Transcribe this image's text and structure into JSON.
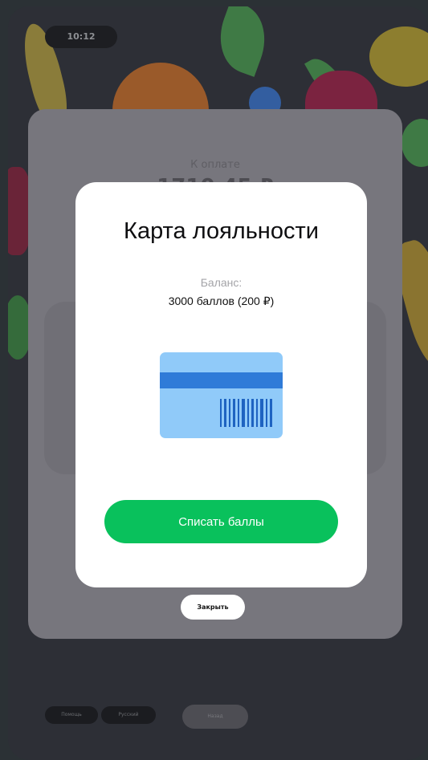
{
  "status": {
    "time": "10:12"
  },
  "payment_panel": {
    "label": "К оплате",
    "amount": "1710.45 ₽"
  },
  "loyalty_modal": {
    "title": "Карта лояльности",
    "balance_label": "Баланс:",
    "balance_value": "3000 баллов (200 ₽)",
    "action_label": "Списать баллы",
    "card_icon": "loyalty-card-icon"
  },
  "close_label": "Закрыть",
  "footer": {
    "help_label": "Помощь",
    "language_label": "Русский",
    "back_label": "Назад"
  },
  "colors": {
    "accent": "#09c15c",
    "card_light": "#90caf9",
    "card_stripe": "#2f7bd8",
    "card_barcode": "#1e63c1"
  }
}
